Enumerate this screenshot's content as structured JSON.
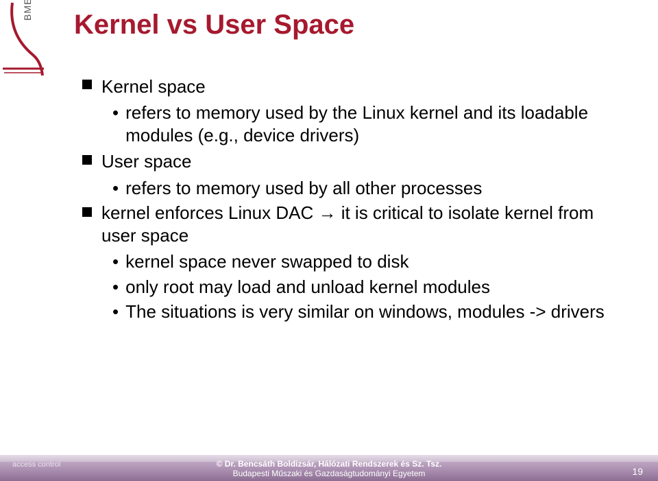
{
  "logo": {
    "bme_label": "BME"
  },
  "title": "Kernel vs User Space",
  "bullets": {
    "b1": {
      "label": "Kernel space"
    },
    "b1_1": {
      "text": "refers to memory used by the Linux kernel and its loadable modules (e.g., device drivers)"
    },
    "b2": {
      "label": "User space"
    },
    "b2_1": {
      "text": "refers to memory used by all other processes"
    },
    "b3": {
      "text_pre": "kernel enforces Linux DAC ",
      "arrow": "→",
      "text_post": " it is critical to isolate kernel from user space"
    },
    "b3_1": {
      "text": "kernel space never swapped to disk"
    },
    "b3_2": {
      "text": "only root may load and unload kernel modules"
    },
    "b3_3": {
      "text": "The situations is very similar on windows, modules -> drivers"
    }
  },
  "footer": {
    "left": "access control",
    "center_top": "©  Dr. Bencsáth Boldizsár, Hálózati Rendszerek és Sz. Tsz.",
    "center_bottom": "Budapesti Műszaki és Gazdaságtudományi Egyetem",
    "page": "19"
  }
}
